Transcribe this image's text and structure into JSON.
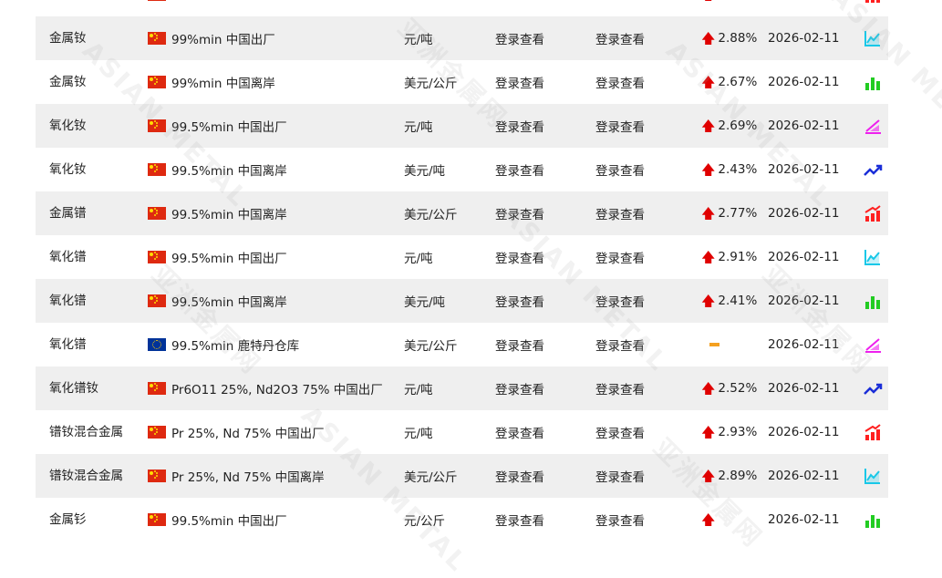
{
  "watermark": {
    "text_en": "ASIAN METAL",
    "text_cn": "亚洲金属网"
  },
  "table": {
    "rows": [
      {
        "name": "",
        "flag": "cn",
        "spec": "",
        "unit": "",
        "price1": "",
        "price2": "",
        "change": "",
        "trend": "up",
        "date": "",
        "chart_icon": "bar-rise-icon",
        "chart_color": "#ff2020"
      },
      {
        "name": "金属钕",
        "flag": "cn",
        "spec": "99%min 中国出厂",
        "unit": "元/吨",
        "price1": "登录查看",
        "price2": "登录查看",
        "change": "2.88%",
        "trend": "up",
        "date": "2026-02-11",
        "chart_icon": "line-area-icon",
        "chart_color": "#18c8e8"
      },
      {
        "name": "金属钕",
        "flag": "cn",
        "spec": "99%min 中国离岸",
        "unit": "美元/公斤",
        "price1": "登录查看",
        "price2": "登录查看",
        "change": "2.67%",
        "trend": "up",
        "date": "2026-02-11",
        "chart_icon": "bar-chart-icon",
        "chart_color": "#22cc22"
      },
      {
        "name": "氧化钕",
        "flag": "cn",
        "spec": "99.5%min 中国出厂",
        "unit": "元/吨",
        "price1": "登录查看",
        "price2": "登录查看",
        "change": "2.69%",
        "trend": "up",
        "date": "2026-02-11",
        "chart_icon": "area-chart-icon",
        "chart_color": "#ee20ee"
      },
      {
        "name": "氧化钕",
        "flag": "cn",
        "spec": "99.5%min 中国离岸",
        "unit": "美元/吨",
        "price1": "登录查看",
        "price2": "登录查看",
        "change": "2.43%",
        "trend": "up",
        "date": "2026-02-11",
        "chart_icon": "trend-line-icon",
        "chart_color": "#1a2ed8"
      },
      {
        "name": "金属镨",
        "flag": "cn",
        "spec": "99.5%min 中国离岸",
        "unit": "美元/公斤",
        "price1": "登录查看",
        "price2": "登录查看",
        "change": "2.77%",
        "trend": "up",
        "date": "2026-02-11",
        "chart_icon": "bar-rise-icon",
        "chart_color": "#ff2020"
      },
      {
        "name": "氧化镨",
        "flag": "cn",
        "spec": "99.5%min 中国出厂",
        "unit": "元/吨",
        "price1": "登录查看",
        "price2": "登录查看",
        "change": "2.91%",
        "trend": "up",
        "date": "2026-02-11",
        "chart_icon": "line-area-icon",
        "chart_color": "#18c8e8"
      },
      {
        "name": "氧化镨",
        "flag": "cn",
        "spec": "99.5%min 中国离岸",
        "unit": "美元/吨",
        "price1": "登录查看",
        "price2": "登录查看",
        "change": "2.41%",
        "trend": "up",
        "date": "2026-02-11",
        "chart_icon": "bar-chart-icon",
        "chart_color": "#22cc22"
      },
      {
        "name": "氧化镨",
        "flag": "eu",
        "spec": "99.5%min 鹿特丹仓库",
        "unit": "美元/公斤",
        "price1": "登录查看",
        "price2": "登录查看",
        "change": "",
        "trend": "flat",
        "date": "2026-02-11",
        "chart_icon": "area-chart-icon",
        "chart_color": "#ee20ee"
      },
      {
        "name": "氧化镨钕",
        "flag": "cn",
        "spec": "Pr6O11 25%, Nd2O3 75% 中国出厂",
        "unit": "元/吨",
        "price1": "登录查看",
        "price2": "登录查看",
        "change": "2.52%",
        "trend": "up",
        "date": "2026-02-11",
        "chart_icon": "trend-line-icon",
        "chart_color": "#1a2ed8"
      },
      {
        "name": "镨钕混合金属",
        "flag": "cn",
        "spec": "Pr 25%, Nd 75% 中国出厂",
        "unit": "元/吨",
        "price1": "登录查看",
        "price2": "登录查看",
        "change": "2.93%",
        "trend": "up",
        "date": "2026-02-11",
        "chart_icon": "bar-rise-icon",
        "chart_color": "#ff2020"
      },
      {
        "name": "镨钕混合金属",
        "flag": "cn",
        "spec": "Pr 25%, Nd 75% 中国离岸",
        "unit": "美元/公斤",
        "price1": "登录查看",
        "price2": "登录查看",
        "change": "2.89%",
        "trend": "up",
        "date": "2026-02-11",
        "chart_icon": "line-area-icon",
        "chart_color": "#18c8e8"
      },
      {
        "name": "金属钐",
        "flag": "cn",
        "spec": "99.5%min 中国出厂",
        "unit": "元/公斤",
        "price1": "登录查看",
        "price2": "登录查看",
        "change": "",
        "trend": "up",
        "date": "2026-02-11",
        "chart_icon": "bar-chart-icon",
        "chart_color": "#22cc22"
      }
    ]
  }
}
